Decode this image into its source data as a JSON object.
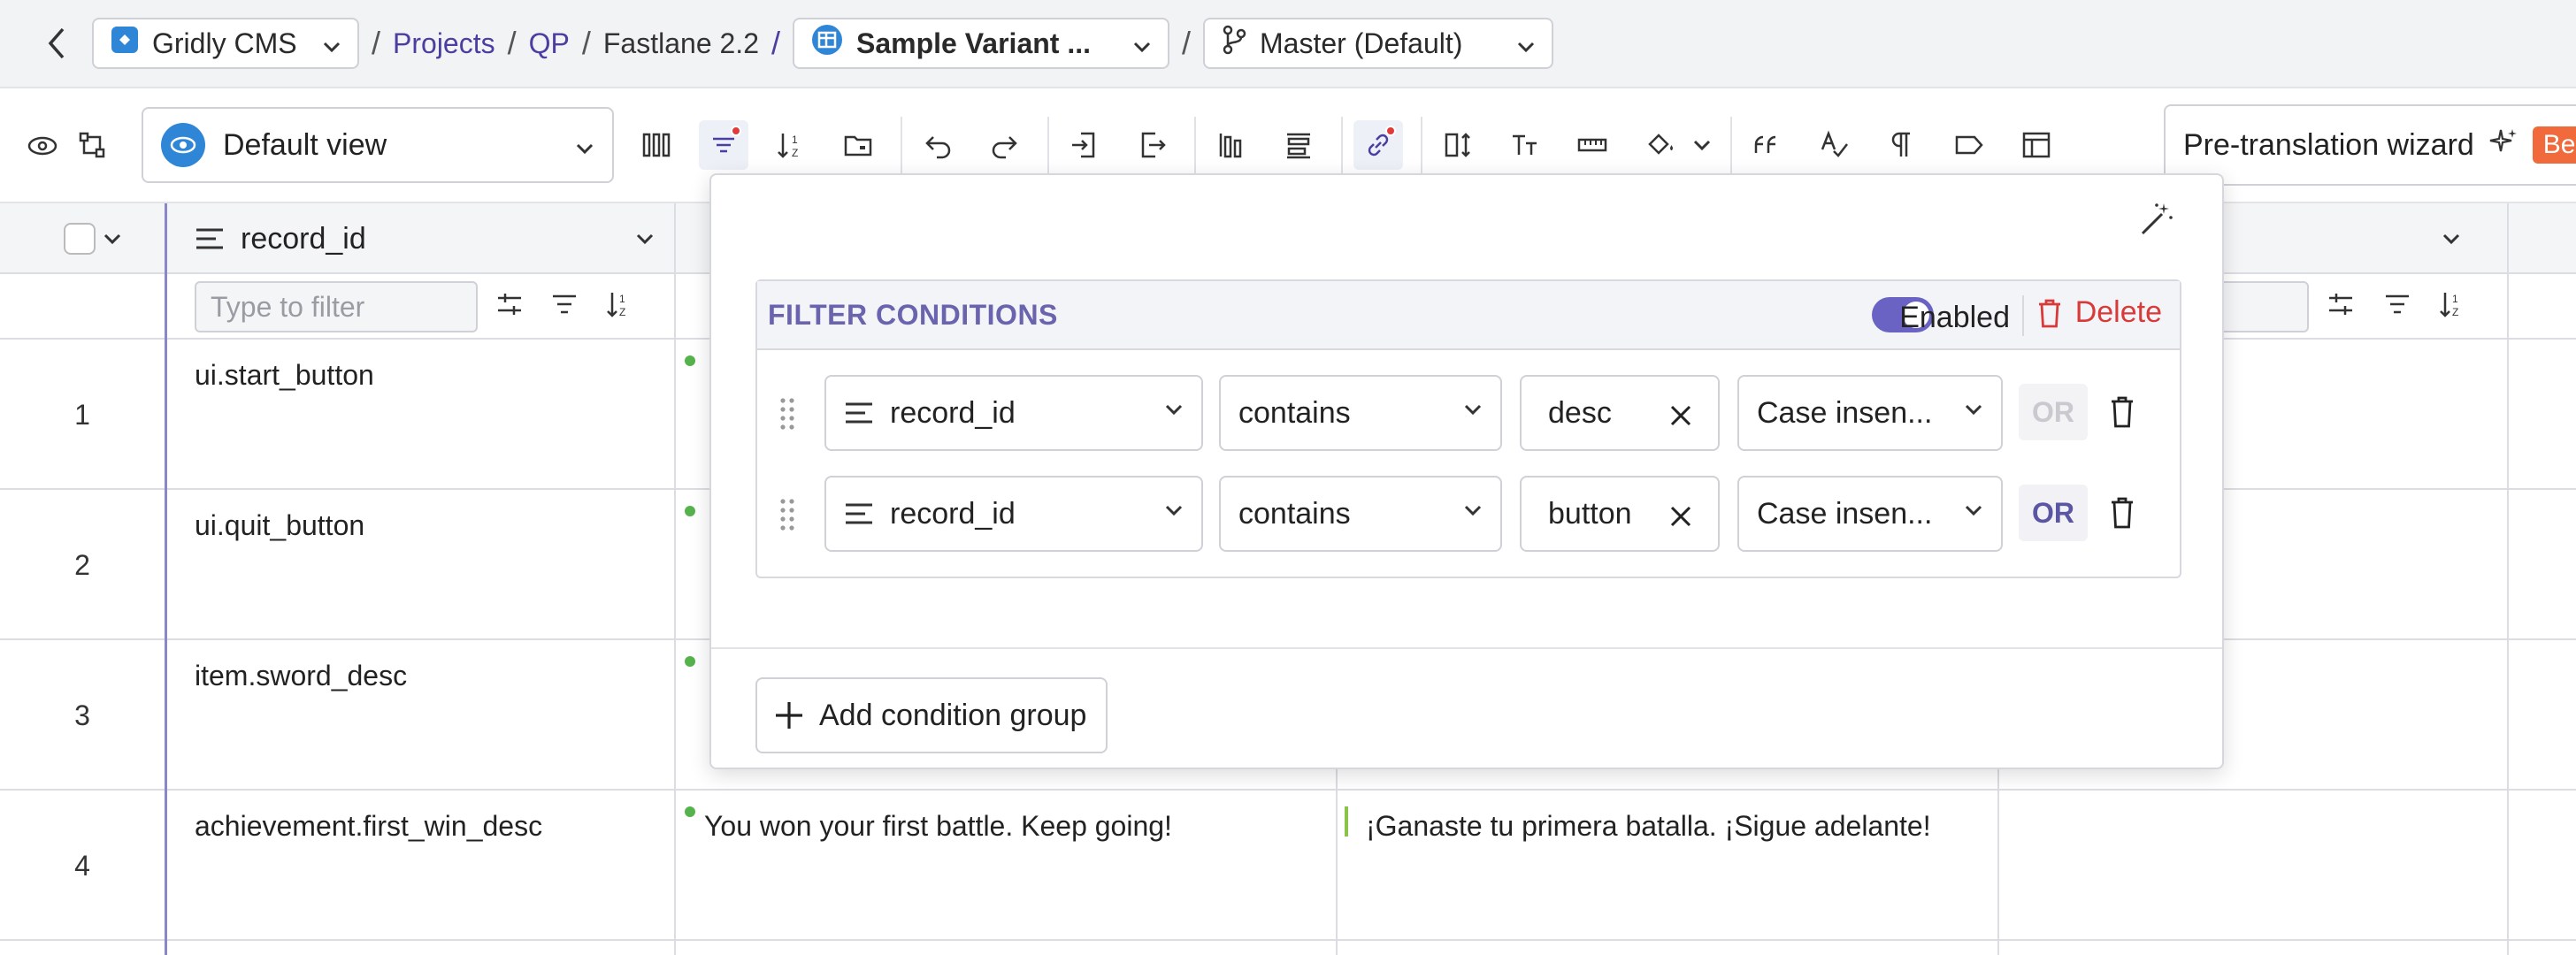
{
  "breadcrumb": {
    "workspace": "Gridly CMS",
    "projects": "Projects",
    "project": "QP",
    "database": "Fastlane 2.2",
    "grid": "Sample Variant ...",
    "branch": "Master (Default)"
  },
  "toolbar": {
    "view_label": "Default view",
    "wizard_label": "Pre-translation wizard",
    "beta_label": "Be"
  },
  "columns": {
    "record_id": "record_id",
    "filter_placeholder": "Type to filter"
  },
  "rows": [
    {
      "num": "1",
      "record_id": "ui.start_button",
      "col2": "",
      "col3": ""
    },
    {
      "num": "2",
      "record_id": "ui.quit_button",
      "col2": "",
      "col3": ""
    },
    {
      "num": "3",
      "record_id": "item.sword_desc",
      "col2": "",
      "col3": ""
    },
    {
      "num": "4",
      "record_id": "achievement.first_win_desc",
      "col2": "You won your first battle. Keep going!",
      "col3": "¡Ganaste tu primera batalla. ¡Sigue adelante!"
    }
  ],
  "filter": {
    "title": "FILTER CONDITIONS",
    "enabled_label": "Enabled",
    "delete_label": "Delete",
    "conditions": [
      {
        "column": "record_id",
        "operator": "contains",
        "value": "desc",
        "case": "Case insen...",
        "or": "OR"
      },
      {
        "column": "record_id",
        "operator": "contains",
        "value": "button",
        "case": "Case insen...",
        "or": "OR"
      }
    ],
    "add_group_label": "Add condition group"
  },
  "colors": {
    "accent": "#4a3fa0",
    "toggle": "#6a63c4",
    "delete": "#d83a3a",
    "eye": "#2f86d6"
  }
}
